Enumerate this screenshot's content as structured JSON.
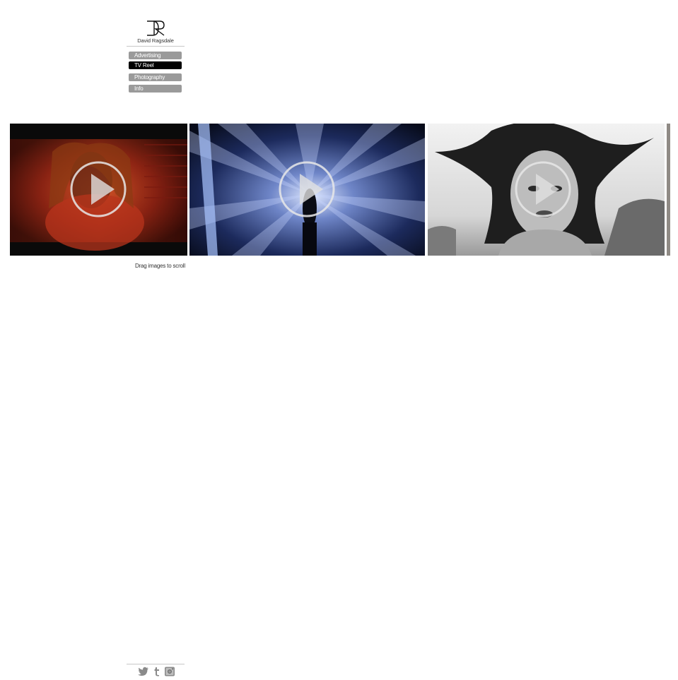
{
  "brand": {
    "monogram": "DR",
    "name": "David Ragsdale"
  },
  "nav": {
    "items": [
      {
        "label": "Advertising",
        "active": false
      },
      {
        "label": "TV Reel",
        "active": true
      },
      {
        "label": "Photography",
        "active": false
      },
      {
        "label": "Info",
        "active": false
      }
    ]
  },
  "reel": {
    "hint": "Drag images to scroll",
    "thumbnails": [
      {
        "tone": "red-orange",
        "icon": "play-icon"
      },
      {
        "tone": "blue-light-beams",
        "icon": "play-icon"
      },
      {
        "tone": "black-and-white",
        "icon": "play-icon"
      }
    ]
  },
  "footer": {
    "social": [
      "twitter-icon",
      "tumblr-icon",
      "instagram-icon"
    ]
  },
  "colors": {
    "nav_inactive": "#9a9a9a",
    "nav_active": "#000000",
    "rule": "#c8c8c8"
  }
}
